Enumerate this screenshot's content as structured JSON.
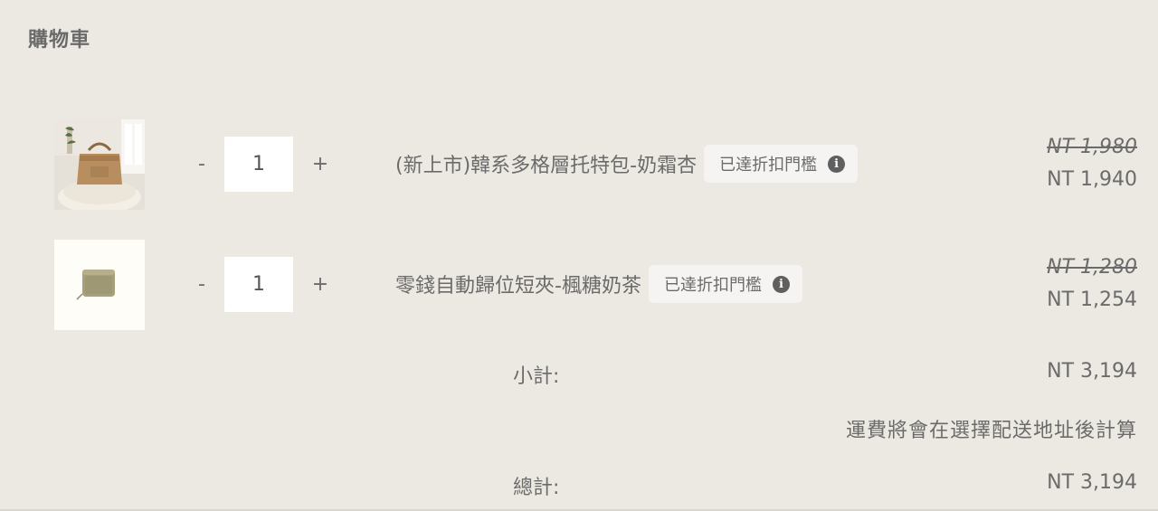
{
  "page": {
    "title": "購物車"
  },
  "cart": {
    "items": [
      {
        "image_icon": "tote-bag-photo",
        "quantity": "1",
        "minus_label": "-",
        "plus_label": "+",
        "name": "(新上市)韓系多格層托特包-奶霜杏",
        "badge": "已達折扣門檻",
        "original_price": "NT 1,980",
        "final_price": "NT 1,940"
      },
      {
        "image_icon": "wallet-photo",
        "quantity": "1",
        "minus_label": "-",
        "plus_label": "+",
        "name": "零錢自動歸位短夾-楓糖奶茶",
        "badge": "已達折扣門檻",
        "original_price": "NT 1,280",
        "final_price": "NT 1,254"
      }
    ]
  },
  "summary": {
    "subtotal_label": "小計:",
    "subtotal_value": "NT 3,194",
    "shipping_note": "運費將會在選擇配送地址後計算",
    "total_label": "總計:",
    "total_value": "NT 3,194"
  },
  "icons": {
    "info": "info-icon"
  }
}
